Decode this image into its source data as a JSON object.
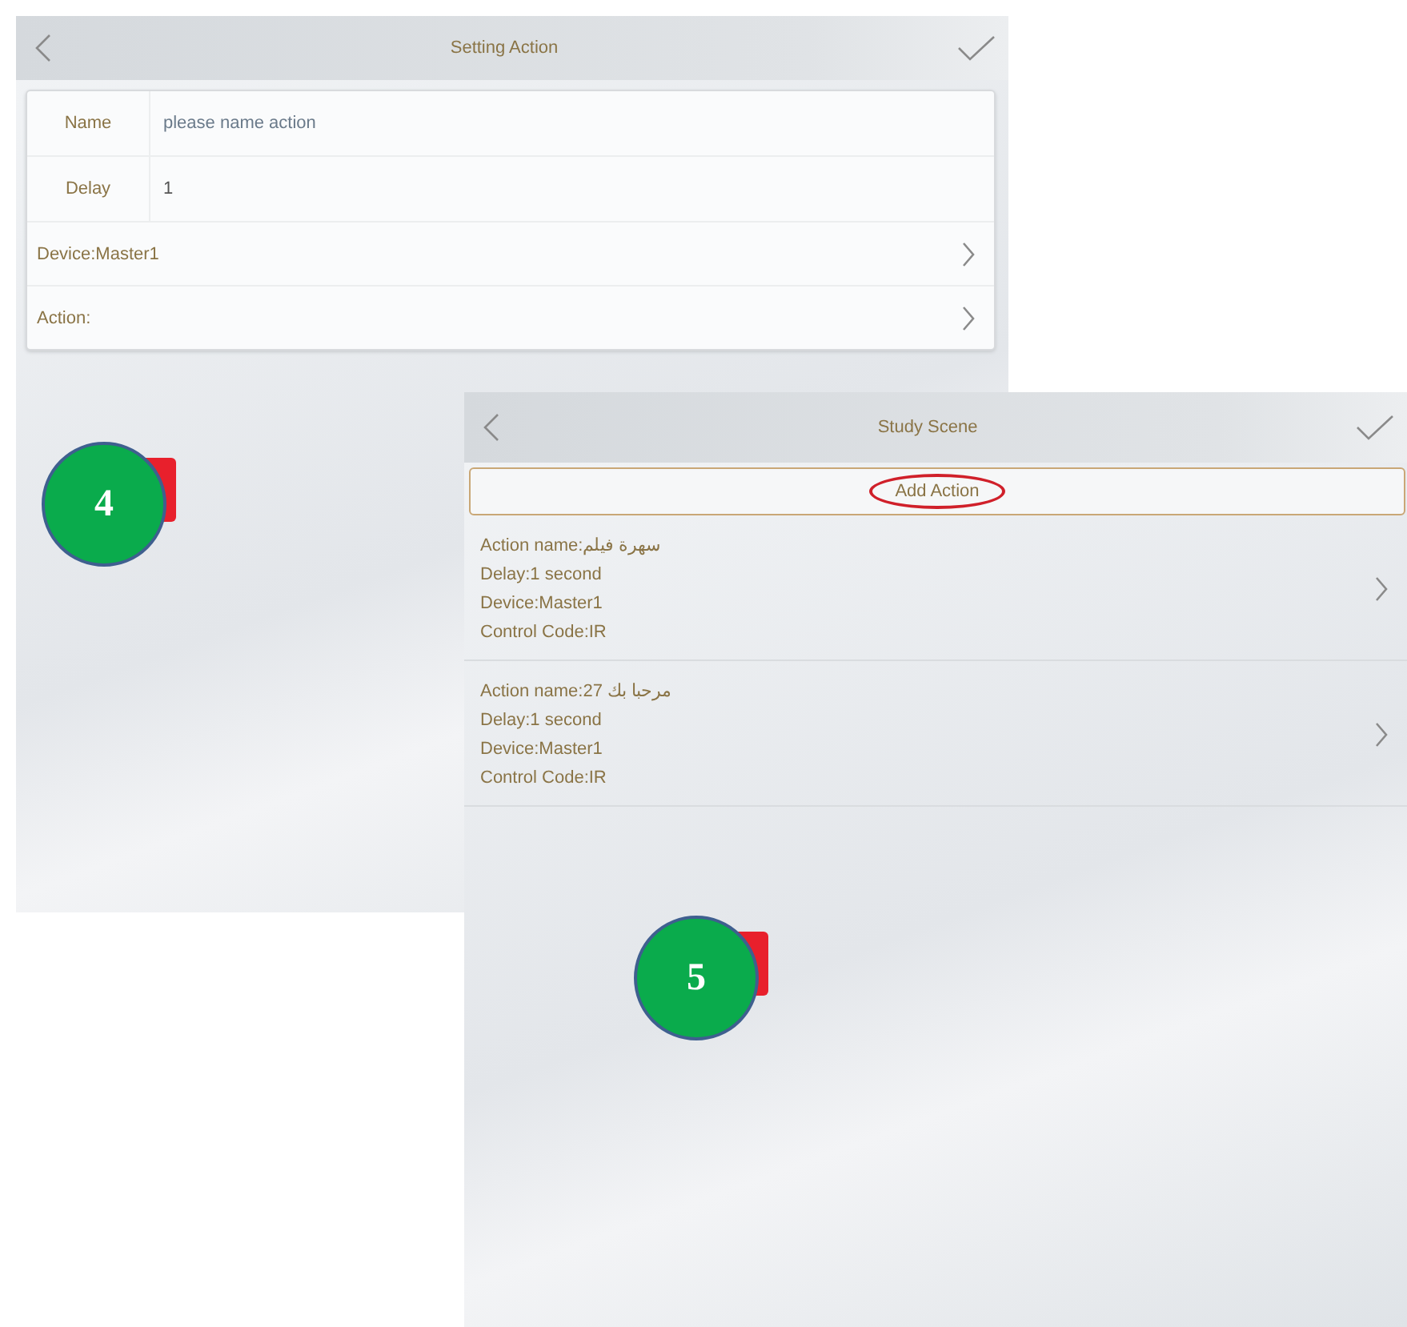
{
  "screens": [
    {
      "title": "Setting Action",
      "step": "4",
      "form": {
        "fields": [
          {
            "label": "Name",
            "placeholder": "please name action"
          },
          {
            "label": "Delay",
            "value": "1"
          }
        ],
        "links": [
          "Device:Master1",
          "Action:"
        ]
      }
    },
    {
      "title": "Study Scene",
      "step": "5",
      "add_button": {
        "label": "Add Action",
        "circled": true
      },
      "actions": [
        {
          "lines": [
            "Action name:سهرة فيلم",
            "Delay:1 second",
            "Device:Master1",
            "Control Code:IR"
          ]
        },
        {
          "lines": [
            "Action name:مرحبا بك 27",
            "Delay:1 second",
            "Device:Master1",
            "Control Code:IR"
          ]
        }
      ]
    }
  ]
}
